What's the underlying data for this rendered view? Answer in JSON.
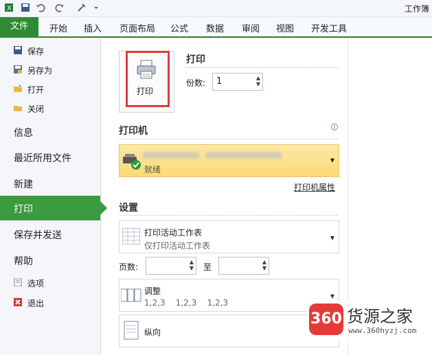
{
  "window": {
    "title": "工作簿"
  },
  "ribbon": {
    "file_tab": "文件",
    "tabs": [
      "开始",
      "插入",
      "页面布局",
      "公式",
      "数据",
      "审阅",
      "视图",
      "开发工具"
    ]
  },
  "nav": {
    "small_items": [
      "保存",
      "另存为",
      "打开",
      "关闭"
    ],
    "big_items": [
      "信息",
      "最近所用文件",
      "新建",
      "打印",
      "保存并发送",
      "帮助"
    ],
    "bottom_items": [
      "选项",
      "退出"
    ]
  },
  "print_section": {
    "heading": "打印",
    "button_label": "打印",
    "copies_label": "份数:",
    "copies_value": "1"
  },
  "printer": {
    "heading": "打印机",
    "status": "就绪",
    "properties_link": "打印机属性"
  },
  "settings": {
    "heading": "设置",
    "scope": {
      "title": "打印活动工作表",
      "sub": "仅打印活动工作表"
    },
    "pages_label": "页数:",
    "to_label": "至",
    "collate": {
      "title": "调整",
      "sub": "1,2,3    1,2,3    1,2,3"
    },
    "orientation": {
      "title": "纵向"
    }
  },
  "watermark": {
    "badge": "360",
    "name": "货源之家",
    "url": "www.360hyzj.com"
  },
  "colors": {
    "accent": "#3c9a3f",
    "file_tab": "#2e8b34",
    "highlight": "#fbd977",
    "red_box": "#e0393a"
  }
}
